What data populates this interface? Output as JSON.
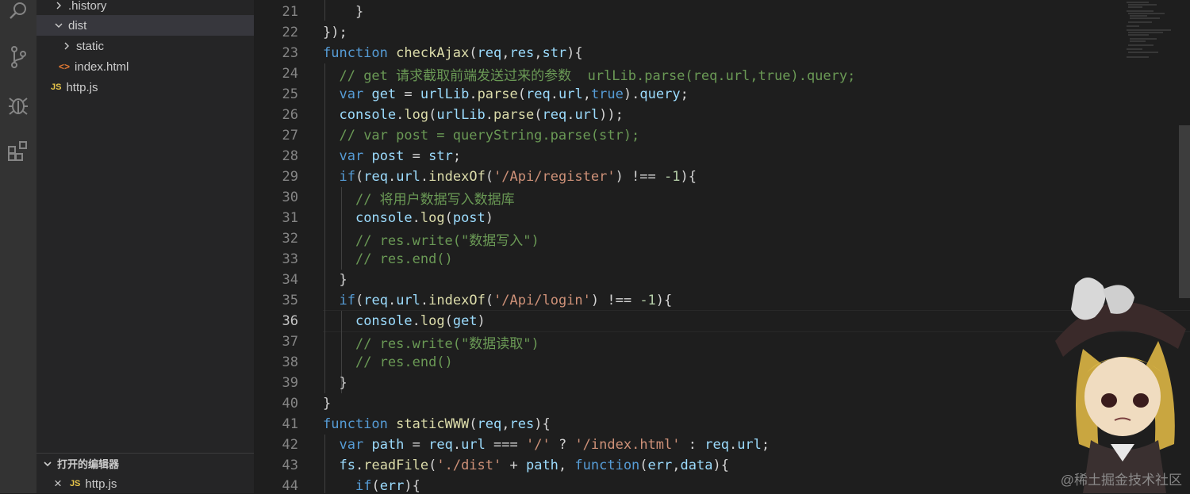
{
  "explorer": {
    "items": [
      {
        "label": ".history",
        "type": "folder",
        "expanded": false,
        "icon": "chevron-right-icon"
      },
      {
        "label": "dist",
        "type": "folder",
        "expanded": true,
        "icon": "chevron-down-icon"
      },
      {
        "label": "static",
        "type": "folder",
        "expanded": false,
        "icon": "chevron-right-icon"
      },
      {
        "label": "index.html",
        "type": "file",
        "icon": "html-file-icon",
        "badge": "<>"
      },
      {
        "label": "http.js",
        "type": "file",
        "icon": "js-file-icon",
        "badge": "JS"
      }
    ],
    "open_editors": {
      "title": "打开的编辑器",
      "items": [
        {
          "label": "http.js",
          "badge": "JS",
          "close": "×"
        }
      ]
    }
  },
  "activity_bar": {
    "icons": [
      "search-icon",
      "source-control-icon",
      "debug-icon",
      "extensions-icon"
    ]
  },
  "editor": {
    "active_line": "36",
    "lines": [
      {
        "n": "21",
        "t": "    }"
      },
      {
        "n": "22",
        "t": "});"
      },
      {
        "n": "23",
        "t": "function checkAjax(req,res,str){"
      },
      {
        "n": "24",
        "t": "  // get 请求截取前端发送过来的参数  urlLib.parse(req.url,true).query;"
      },
      {
        "n": "25",
        "t": "  var get = urlLib.parse(req.url,true).query;"
      },
      {
        "n": "26",
        "t": "  console.log(urlLib.parse(req.url));"
      },
      {
        "n": "27",
        "t": "  // var post = queryString.parse(str);"
      },
      {
        "n": "28",
        "t": "  var post = str;"
      },
      {
        "n": "29",
        "t": "  if(req.url.indexOf('/Api/register') !== -1){"
      },
      {
        "n": "30",
        "t": "    // 将用户数据写入数据库"
      },
      {
        "n": "31",
        "t": "    console.log(post)"
      },
      {
        "n": "32",
        "t": "    // res.write(\"数据写入\")"
      },
      {
        "n": "33",
        "t": "    // res.end()"
      },
      {
        "n": "34",
        "t": "  }"
      },
      {
        "n": "35",
        "t": "  if(req.url.indexOf('/Api/login') !== -1){"
      },
      {
        "n": "36",
        "t": "    console.log(get)"
      },
      {
        "n": "37",
        "t": "    // res.write(\"数据读取\")"
      },
      {
        "n": "38",
        "t": "    // res.end()"
      },
      {
        "n": "39",
        "t": "  }"
      },
      {
        "n": "40",
        "t": "}"
      },
      {
        "n": "41",
        "t": "function staticWWW(req,res){"
      },
      {
        "n": "42",
        "t": "  var path = req.url === '/' ? '/index.html' : req.url;"
      },
      {
        "n": "43",
        "t": "  fs.readFile('./dist' + path, function(err,data){"
      },
      {
        "n": "44",
        "t": "    if(err){"
      }
    ]
  },
  "watermark": "@稀土掘金技术社区",
  "colors": {
    "background": "#1e1e1e",
    "sidebar": "#252526",
    "activity_bar": "#333333",
    "keyword": "#569cd6",
    "function": "#dcdcaa",
    "variable": "#9cdcfe",
    "string": "#ce9178",
    "comment": "#6a9955",
    "number": "#b5cea8"
  }
}
